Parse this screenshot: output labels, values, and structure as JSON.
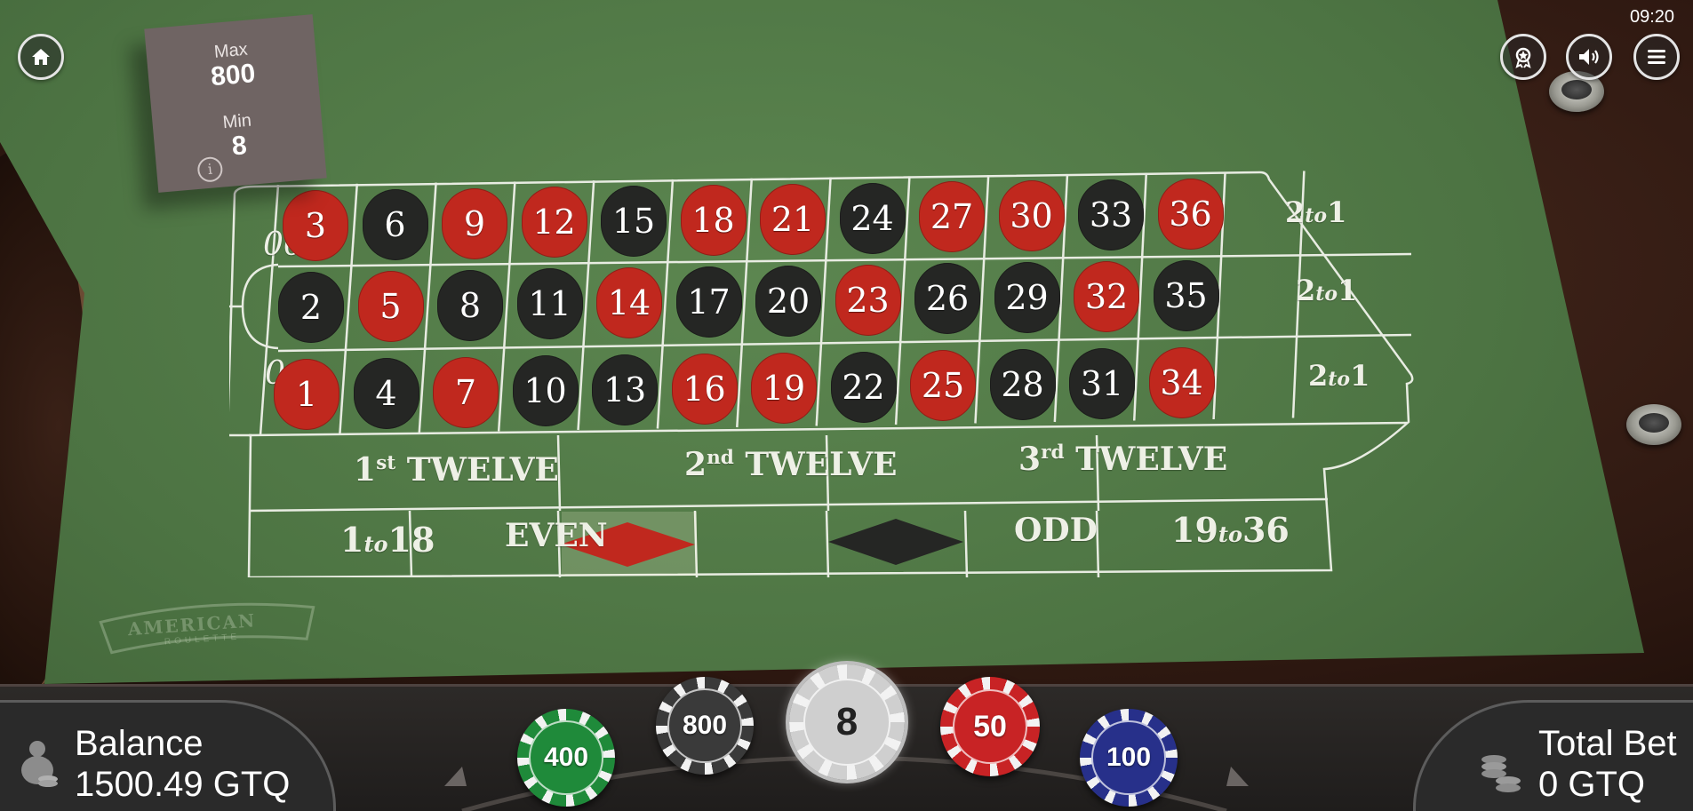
{
  "limits": {
    "max_label": "Max",
    "max_value": "800",
    "min_label": "Min",
    "min_value": "8"
  },
  "status": {
    "clock": "09:20"
  },
  "table": {
    "zero_labels": [
      "00",
      "0"
    ],
    "rows": [
      [
        {
          "n": "3",
          "c": "red"
        },
        {
          "n": "6",
          "c": "black"
        },
        {
          "n": "9",
          "c": "red"
        },
        {
          "n": "12",
          "c": "red"
        },
        {
          "n": "15",
          "c": "black"
        },
        {
          "n": "18",
          "c": "red"
        },
        {
          "n": "21",
          "c": "red"
        },
        {
          "n": "24",
          "c": "black"
        },
        {
          "n": "27",
          "c": "red"
        },
        {
          "n": "30",
          "c": "red"
        },
        {
          "n": "33",
          "c": "black"
        },
        {
          "n": "36",
          "c": "red"
        }
      ],
      [
        {
          "n": "2",
          "c": "black"
        },
        {
          "n": "5",
          "c": "red"
        },
        {
          "n": "8",
          "c": "black"
        },
        {
          "n": "11",
          "c": "black"
        },
        {
          "n": "14",
          "c": "red"
        },
        {
          "n": "17",
          "c": "black"
        },
        {
          "n": "20",
          "c": "black"
        },
        {
          "n": "23",
          "c": "red"
        },
        {
          "n": "26",
          "c": "black"
        },
        {
          "n": "29",
          "c": "black"
        },
        {
          "n": "32",
          "c": "red"
        },
        {
          "n": "35",
          "c": "black"
        }
      ],
      [
        {
          "n": "1",
          "c": "red"
        },
        {
          "n": "4",
          "c": "black"
        },
        {
          "n": "7",
          "c": "red"
        },
        {
          "n": "10",
          "c": "black"
        },
        {
          "n": "13",
          "c": "black"
        },
        {
          "n": "16",
          "c": "red"
        },
        {
          "n": "19",
          "c": "red"
        },
        {
          "n": "22",
          "c": "black"
        },
        {
          "n": "25",
          "c": "red"
        },
        {
          "n": "28",
          "c": "black"
        },
        {
          "n": "31",
          "c": "black"
        },
        {
          "n": "34",
          "c": "red"
        }
      ]
    ],
    "column_bets": [
      {
        "a": "2",
        "to": "to",
        "b": "1"
      },
      {
        "a": "2",
        "to": "to",
        "b": "1"
      },
      {
        "a": "2",
        "to": "to",
        "b": "1"
      }
    ],
    "dozens": [
      {
        "num": "1",
        "suffix": "st",
        "word": "TWELVE"
      },
      {
        "num": "2",
        "suffix": "nd",
        "word": "TWELVE"
      },
      {
        "num": "3",
        "suffix": "rd",
        "word": "TWELVE"
      }
    ],
    "outside": {
      "low": {
        "a": "1",
        "to": "to",
        "b": "18"
      },
      "even": "EVEN",
      "odd": "ODD",
      "high": {
        "a": "19",
        "to": "to",
        "b": "36"
      }
    },
    "colors": {
      "red": "#c0281e",
      "black": "#252624",
      "felt": "#4d7443",
      "line": "#e8ece2"
    }
  },
  "branding": {
    "stamp_title": "AMERICAN",
    "stamp_sub": "ROULETTE"
  },
  "balance": {
    "label": "Balance",
    "value": "1500.49 GTQ"
  },
  "total_bet": {
    "label": "Total Bet",
    "value": "0 GTQ"
  },
  "chips": [
    {
      "value": "400",
      "color": "#1f8a3a",
      "selected": false
    },
    {
      "value": "800",
      "color": "#3a3a3a",
      "selected": false
    },
    {
      "value": "8",
      "color": "#cfcfcf",
      "selected": true
    },
    {
      "value": "50",
      "color": "#c82325",
      "selected": false
    },
    {
      "value": "100",
      "color": "#27308a",
      "selected": false
    }
  ],
  "icons": [
    "home-icon",
    "achievement-icon",
    "sound-icon",
    "menu-icon",
    "info-icon",
    "balance-coins-icon",
    "total-bet-coins-icon"
  ]
}
